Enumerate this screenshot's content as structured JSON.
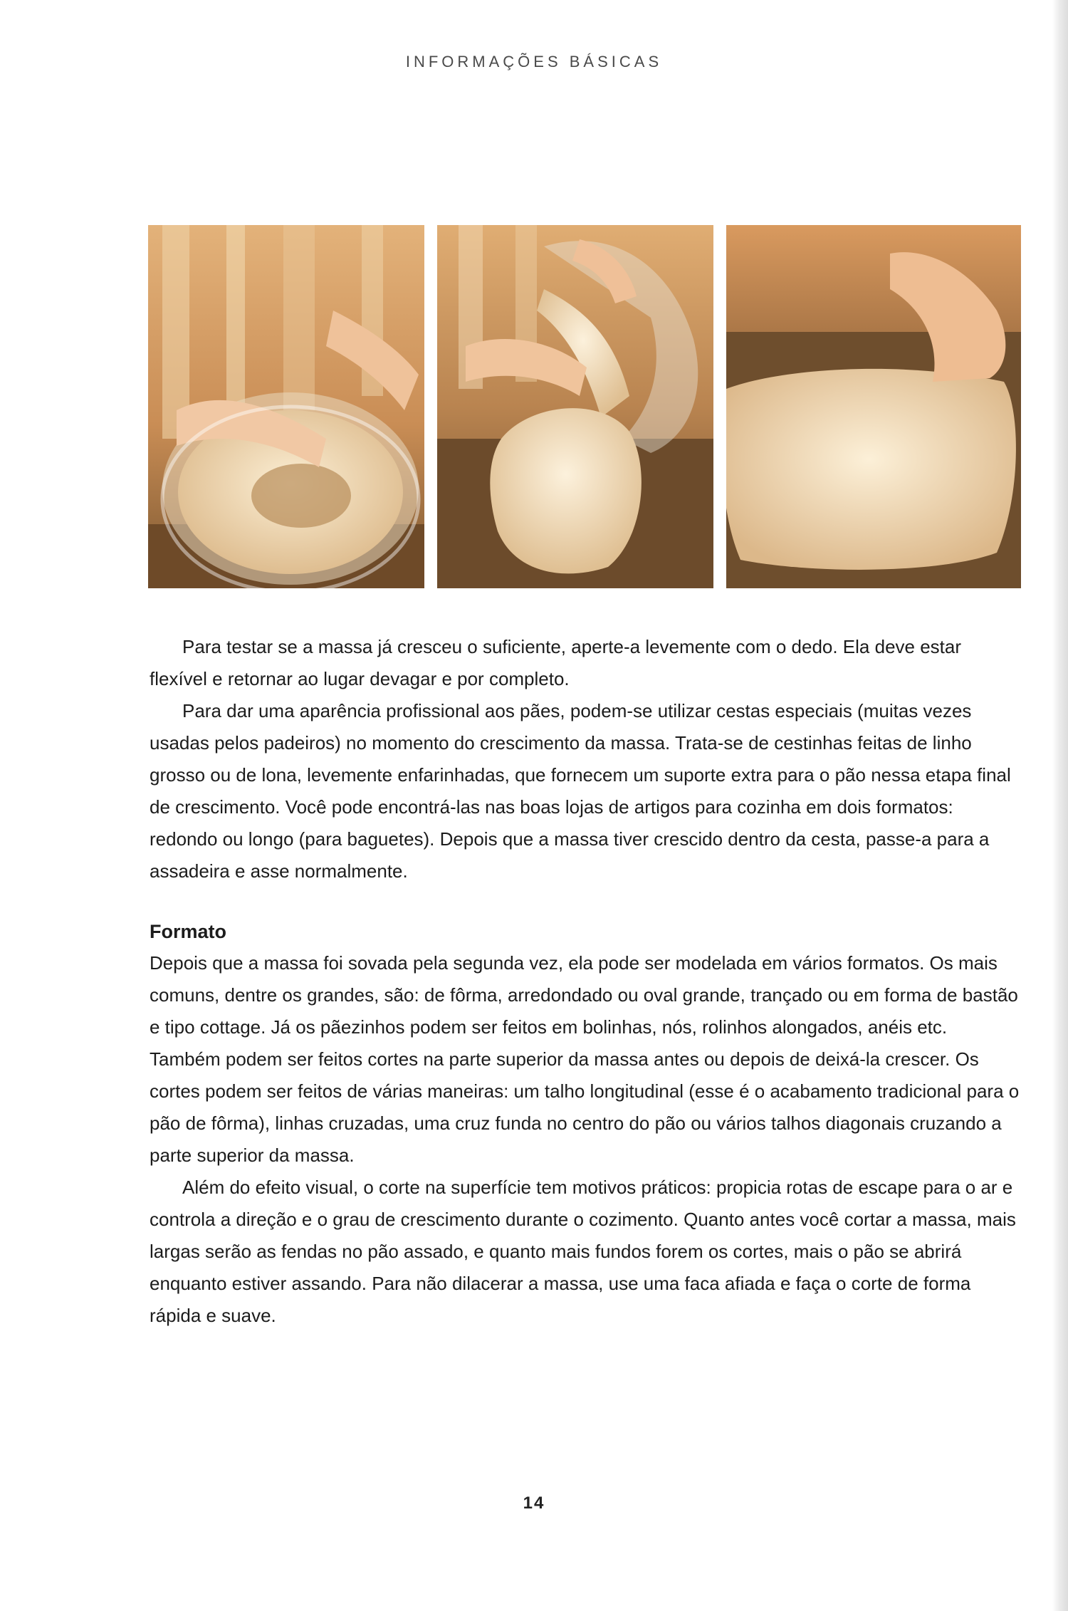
{
  "header": {
    "running_title": "INFORMAÇÕES BÁSICAS"
  },
  "figures": [
    {
      "icon": "photo-dough-in-bowl"
    },
    {
      "icon": "photo-dough-pulled-from-bowl"
    },
    {
      "icon": "photo-dough-pressed-on-counter"
    }
  ],
  "content": {
    "para1": "Para testar se a massa já cresceu o suficiente, aperte-a levemente com o dedo. Ela deve estar flexível e retornar ao lugar devagar e por completo.",
    "para2": "Para dar uma aparência profissional aos pães, podem-se utilizar cestas especiais (muitas vezes usadas pelos padeiros) no momento do crescimento da massa. Trata-se de cestinhas feitas de linho grosso ou de lona, levemente enfarinhadas, que fornecem um suporte extra para o pão nessa etapa final de crescimento. Você pode encontrá-las nas boas lojas de artigos para cozinha em dois formatos: redondo ou longo (para baguetes). Depois que a massa tiver crescido dentro da cesta, passe-a para a assadeira e asse normalmente.",
    "section_heading": "Formato",
    "para3": "Depois que a massa foi sovada pela segunda vez, ela pode ser modelada em vários formatos. Os mais comuns, dentre os grandes, são: de fôrma, arredondado ou oval grande, trançado ou em forma de bastão e tipo cottage. Já os pãezinhos podem ser feitos em bolinhas, nós, rolinhos alongados, anéis etc. Também podem ser feitos cortes na parte superior da massa antes ou depois de deixá-la crescer. Os cortes podem ser feitos de várias maneiras: um talho longitudinal (esse é o acabamento tradicional para o pão de fôrma), linhas cruzadas, uma cruz funda no centro do pão ou vários talhos diagonais cruzando a parte superior da massa.",
    "para4": "Além do efeito visual, o corte na superfície tem motivos práticos: propicia rotas de escape para o ar e controla a direção e o grau de crescimento durante o cozimento. Quanto antes você cortar a massa, mais largas serão as fendas no pão assado, e quanto mais fundos forem os cortes, mais o pão se abrirá enquanto estiver assando. Para não dilacerar a massa, use uma faca afiada e faça o corte de forma rápida e suave."
  },
  "footer": {
    "page_number": "14"
  },
  "colors": {
    "text": "#1c1c1c",
    "header_text": "#4a4a4a",
    "dough": "#f1dfbf",
    "counter": "#8a6a3e",
    "apron_stripe": "#c98a45"
  }
}
